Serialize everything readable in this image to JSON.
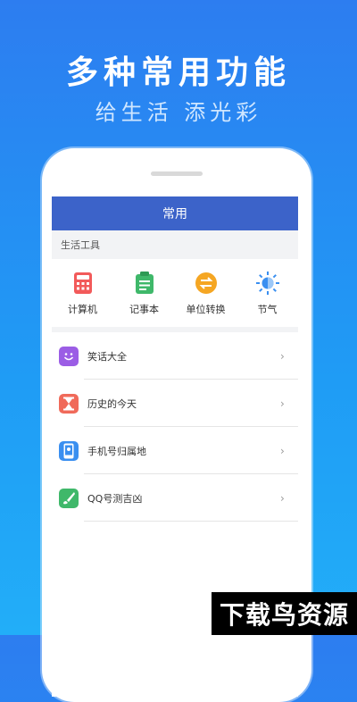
{
  "hero": {
    "title": "多种常用功能",
    "subtitle": "给生活 添光彩"
  },
  "app": {
    "header_title": "常用",
    "section_label": "生活工具",
    "tools": [
      {
        "label": "计算机",
        "icon": "calculator-icon",
        "color": "#f25a5a"
      },
      {
        "label": "记事本",
        "icon": "notepad-icon",
        "color": "#3fb86a"
      },
      {
        "label": "单位转换",
        "icon": "unit-convert-icon",
        "color": "#f5a623"
      },
      {
        "label": "节气",
        "icon": "sun-icon",
        "color": "#3a8ff0"
      }
    ],
    "list": [
      {
        "label": "笑话大全",
        "icon": "smile-icon",
        "color": "#9b5de5"
      },
      {
        "label": "历史的今天",
        "icon": "hourglass-icon",
        "color": "#f06a5a"
      },
      {
        "label": "手机号归属地",
        "icon": "phone-location-icon",
        "color": "#3a8ff0"
      },
      {
        "label": "QQ号测吉凶",
        "icon": "brush-icon",
        "color": "#3fb86a"
      }
    ]
  },
  "watermark": "下载鸟资源"
}
